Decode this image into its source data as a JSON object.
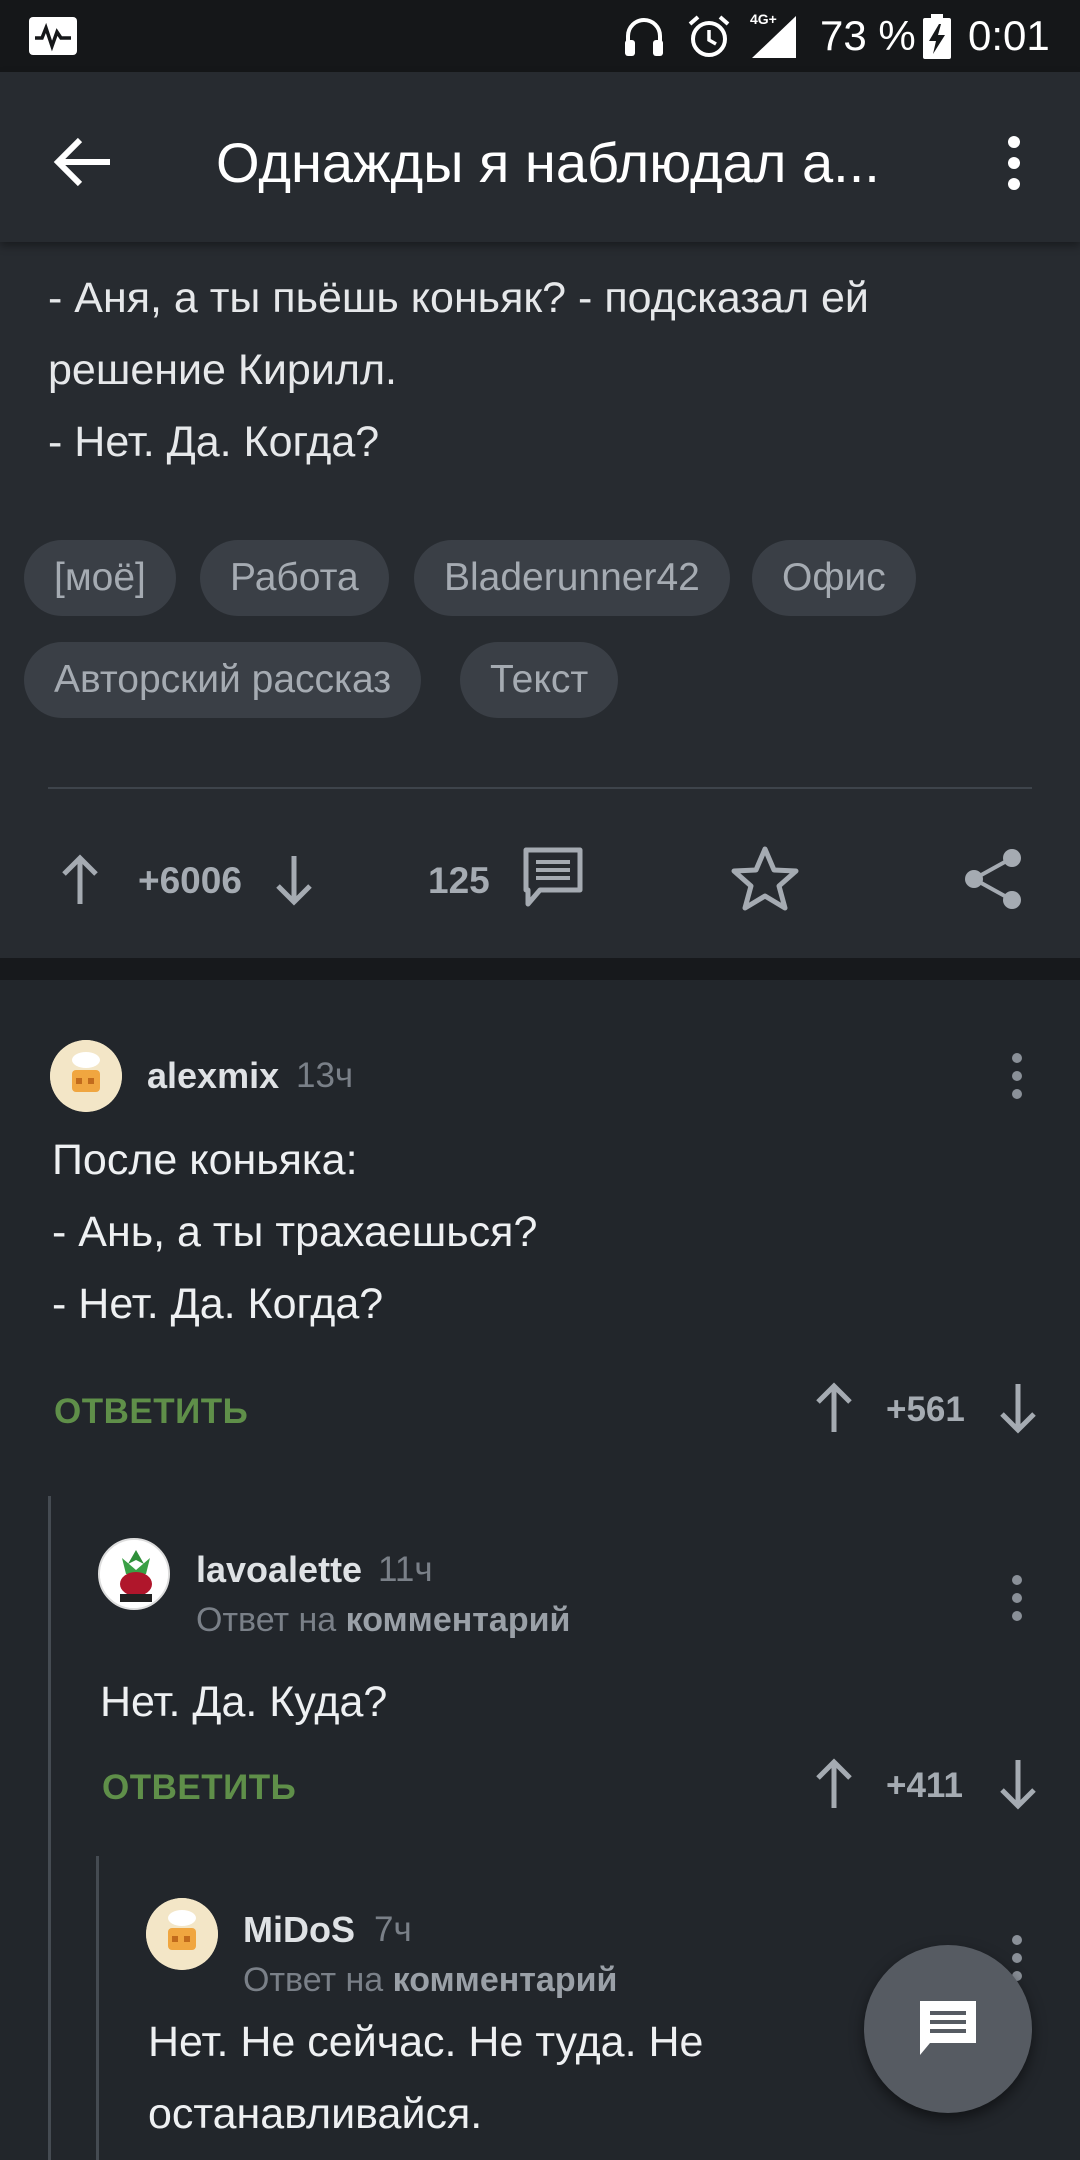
{
  "status_bar": {
    "network": "4G+",
    "battery": "73 %",
    "time": "0:01"
  },
  "app_bar": {
    "title": "Однажды я наблюдал а..."
  },
  "post": {
    "text_lines": [
      "- Аня, а ты пьёшь коньяк? - подсказал ей",
      "решение Кирилл.",
      "- Нет. Да. Когда?"
    ],
    "tags": [
      "[моё]",
      "Работа",
      "Bladerunner42",
      "Офис",
      "Авторский рассказ",
      "Текст"
    ],
    "rating": "+6006",
    "comments_count": "125"
  },
  "comments": [
    {
      "username": "alexmix",
      "time": "13ч",
      "lines": [
        "После коньяка:",
        "- Ань, а ты трахаешься?",
        "- Нет. Да. Когда?"
      ],
      "reply_label": "ОТВЕТИТЬ",
      "rating": "+561"
    },
    {
      "username": "lavoalette",
      "time": "11ч",
      "reply_prefix": "Ответ на",
      "reply_target": "комментарий",
      "lines": [
        "Нет. Да. Куда?"
      ],
      "reply_label": "ОТВЕТИТЬ",
      "rating": "+411"
    },
    {
      "username": "MiDoS",
      "time": "7ч",
      "reply_prefix": "Ответ на",
      "reply_target": "комментарий",
      "lines": [
        "Нет. Не сейчас. Не туда. Не",
        "останавливайся."
      ]
    }
  ],
  "colors": {
    "background": "#22262b",
    "surface": "#272b30",
    "accent_green": "#5f8f49",
    "muted_text": "#a5abb2"
  },
  "icons": {
    "back": "back-arrow-icon",
    "more": "more-vertical-icon",
    "upvote": "arrow-up-icon",
    "downvote": "arrow-down-icon",
    "comments": "comment-icon",
    "save": "star-icon",
    "share": "share-icon",
    "fab": "comment-icon"
  }
}
